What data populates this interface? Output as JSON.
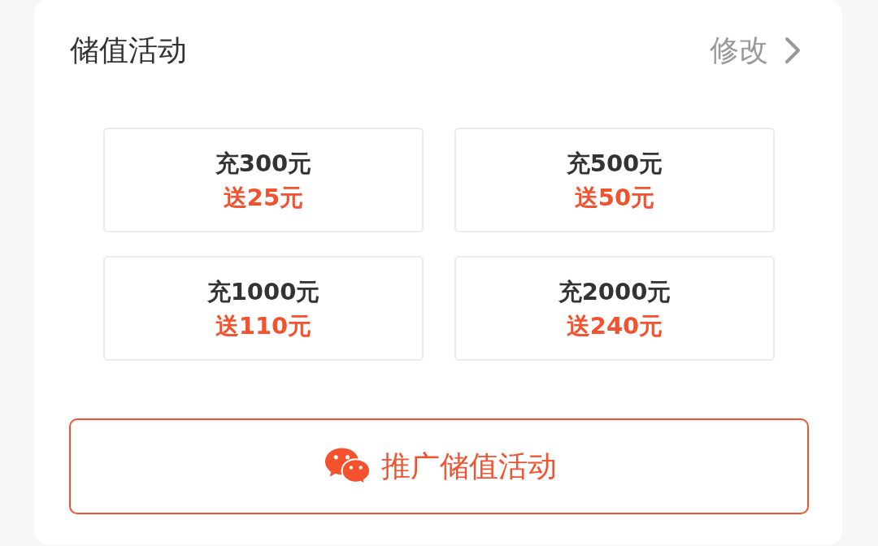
{
  "header": {
    "title": "储值活动",
    "edit_link": "修改"
  },
  "tiers": [
    {
      "recharge": "充300元",
      "bonus": "送25元"
    },
    {
      "recharge": "充500元",
      "bonus": "送50元"
    },
    {
      "recharge": "充1000元",
      "bonus": "送110元"
    },
    {
      "recharge": "充2000元",
      "bonus": "送240元"
    }
  ],
  "promote_button": {
    "label": "推广储值活动"
  }
}
